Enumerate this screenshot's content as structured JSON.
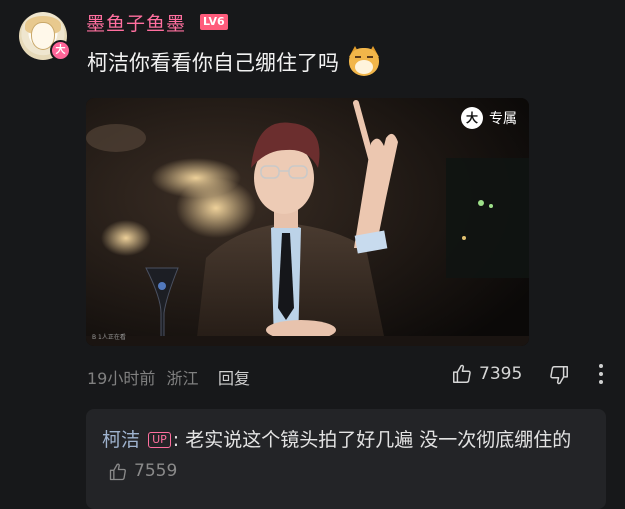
{
  "comment": {
    "username": "墨鱼子鱼墨",
    "level": "LV6",
    "avatar_badge": "大",
    "text": "柯洁你看看你自己绷住了吗",
    "emoji": "doge-emoji",
    "image": {
      "badge_icon": "大",
      "badge_label": "专属",
      "watermark": "B 1人正在看"
    },
    "time": "19小时前",
    "location": "浙江",
    "reply_label": "回复",
    "like_count": "7395"
  },
  "reply": {
    "username": "柯洁",
    "up_tag": "UP",
    "colon": ":",
    "text": " 老实说这个镜头拍了好几遍 没一次彻底绷住的",
    "like_count": "7559"
  },
  "colors": {
    "background": "#17181a",
    "username": "#ff6f9f",
    "level_badge": "#ff5c7c",
    "reply_box": "#232427"
  },
  "icons": [
    "thumbs-up-icon",
    "thumbs-down-icon",
    "more-vertical-icon"
  ]
}
